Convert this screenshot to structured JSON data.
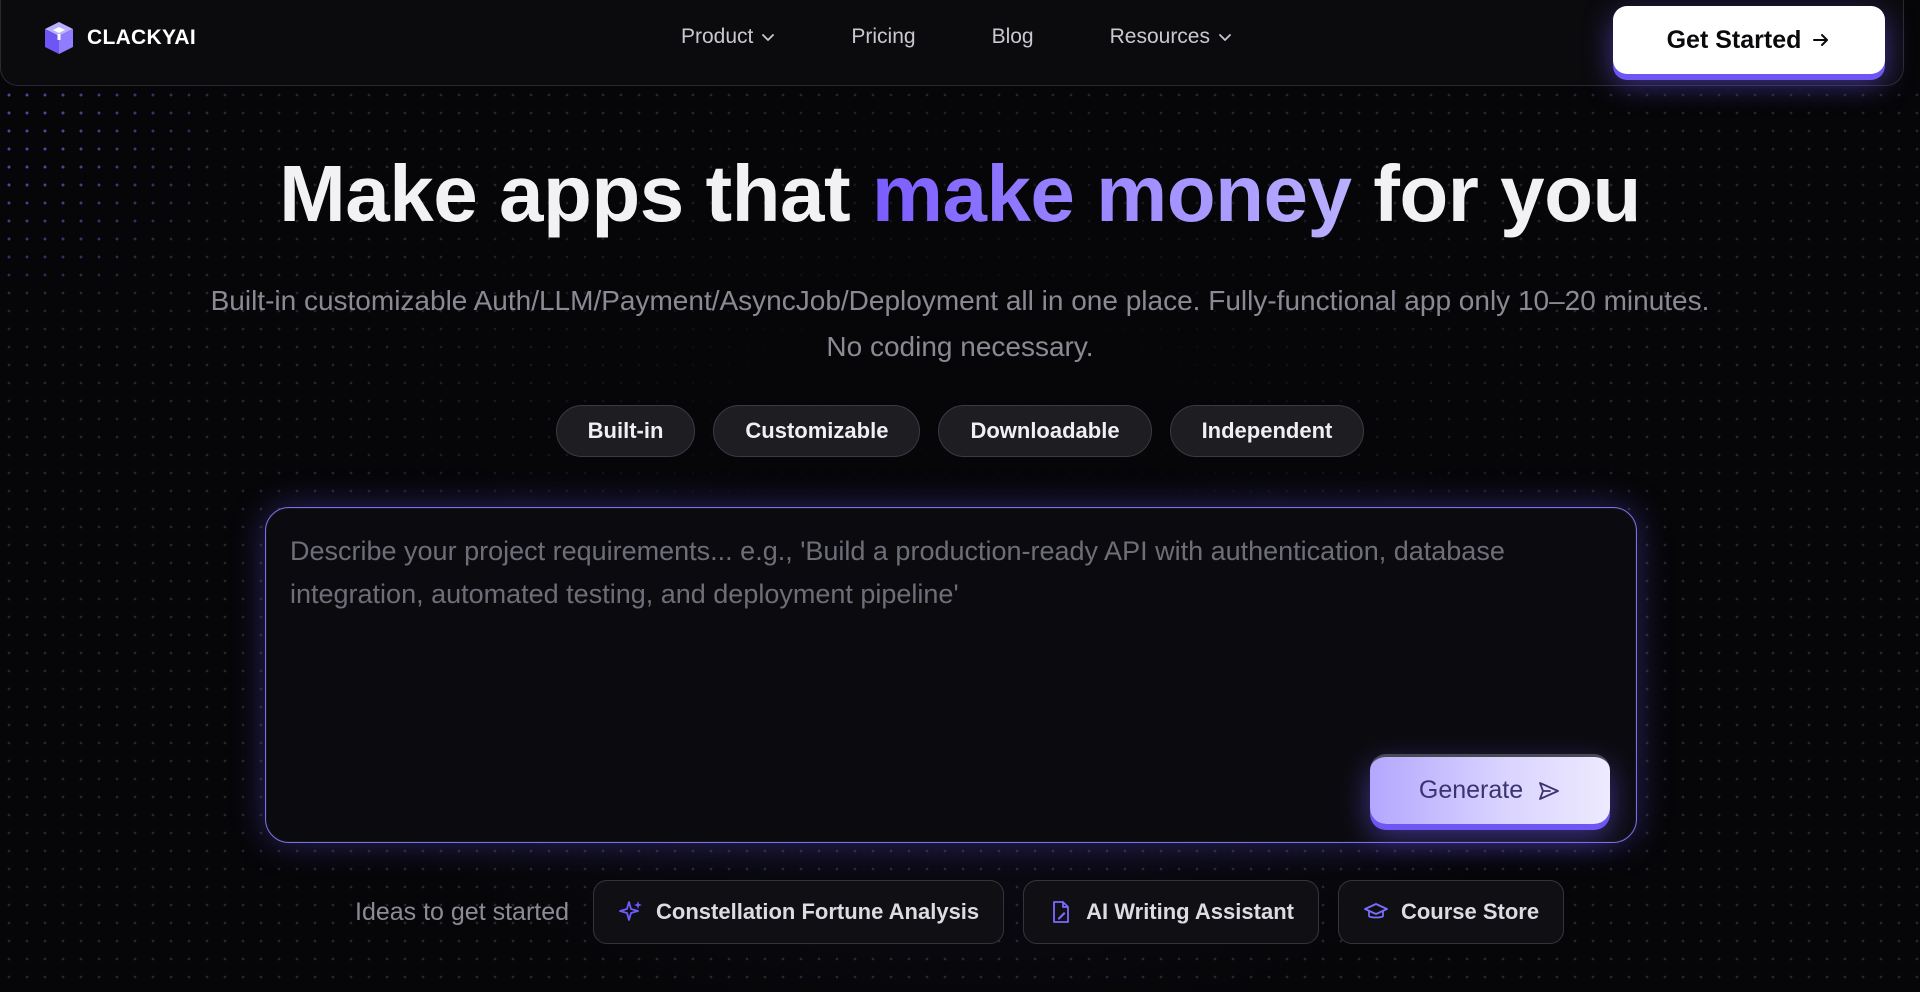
{
  "brand": {
    "name": "CLACKYAI",
    "logo_icon": "cube-logo-icon",
    "accent": "#7b5cff"
  },
  "nav": {
    "links": [
      {
        "label": "Product",
        "has_dropdown": true
      },
      {
        "label": "Pricing",
        "has_dropdown": false
      },
      {
        "label": "Blog",
        "has_dropdown": false
      },
      {
        "label": "Resources",
        "has_dropdown": true
      }
    ],
    "cta_label": "Get Started",
    "cta_icon": "arrow-right-icon"
  },
  "hero": {
    "title_pre": "Make apps that ",
    "title_accent": "make money",
    "title_post": " for you",
    "subtitle": "Built-in customizable Auth/LLM/Payment/AsyncJob/Deployment all in one place. Fully-functional app only 10–20 minutes. No coding necessary.",
    "chips": [
      "Built-in",
      "Customizable",
      "Downloadable",
      "Independent"
    ]
  },
  "prompt": {
    "placeholder": "Describe your project requirements... e.g., 'Build a production-ready API with authentication, database integration, automated testing, and deployment pipeline'",
    "value": "",
    "generate_label": "Generate",
    "generate_icon": "send-icon"
  },
  "ideas": {
    "label": "Ideas to get started",
    "items": [
      {
        "label": "Constellation Fortune Analysis",
        "icon": "sparkles-icon",
        "color": "#6e5cff"
      },
      {
        "label": "AI Writing Assistant",
        "icon": "document-pen-icon",
        "color": "#7a6cff"
      },
      {
        "label": "Course Store",
        "icon": "graduation-cap-icon",
        "color": "#7a6cff"
      }
    ]
  }
}
